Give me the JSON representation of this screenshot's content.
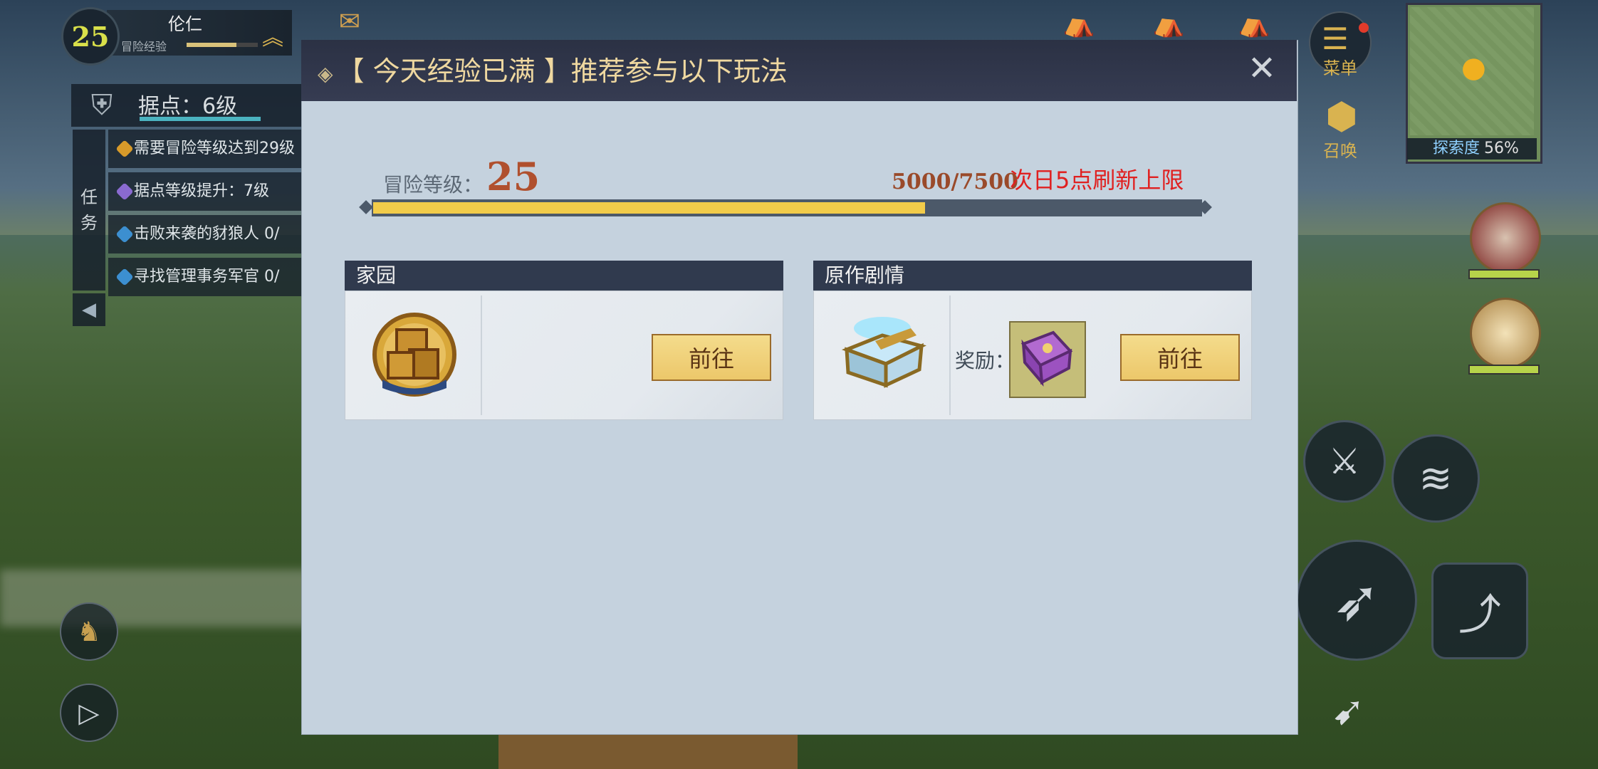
{
  "hud": {
    "level": "25",
    "name": "伦仁",
    "exp_label": "冒险经验",
    "stronghold": "据点：6级",
    "quest_tab": [
      "任",
      "务"
    ],
    "quests": [
      "需要冒险等级达到29级",
      "据点等级提升：7级",
      "击败来袭的豺狼人 0/",
      "寻找管理事务军官 0/"
    ],
    "menu_label": "菜单",
    "summon_label": "召唤",
    "explore_label": "探索度",
    "explore_value": "56%"
  },
  "dialog": {
    "title": "【 今天经验已满 】推荐参与以下玩法",
    "level_label": "冒险等级：",
    "level_value": "25",
    "exp_value": "5000/7500",
    "exp_progress": 0.667,
    "refresh_note": "次日5点刷新上限",
    "cards": [
      {
        "title": "家园",
        "button": "前往"
      },
      {
        "title": "原作剧情",
        "reward_label": "奖励：",
        "button": "前往"
      }
    ]
  },
  "colors": {
    "accent_gold": "#efd8a0",
    "exp_fill": "#f2cc4a",
    "refresh_red": "#e02020"
  },
  "icons": [
    "home-crate-icon",
    "story-book-icon",
    "reward-tome-icon",
    "close-icon",
    "menu-icon",
    "summon-icon"
  ]
}
